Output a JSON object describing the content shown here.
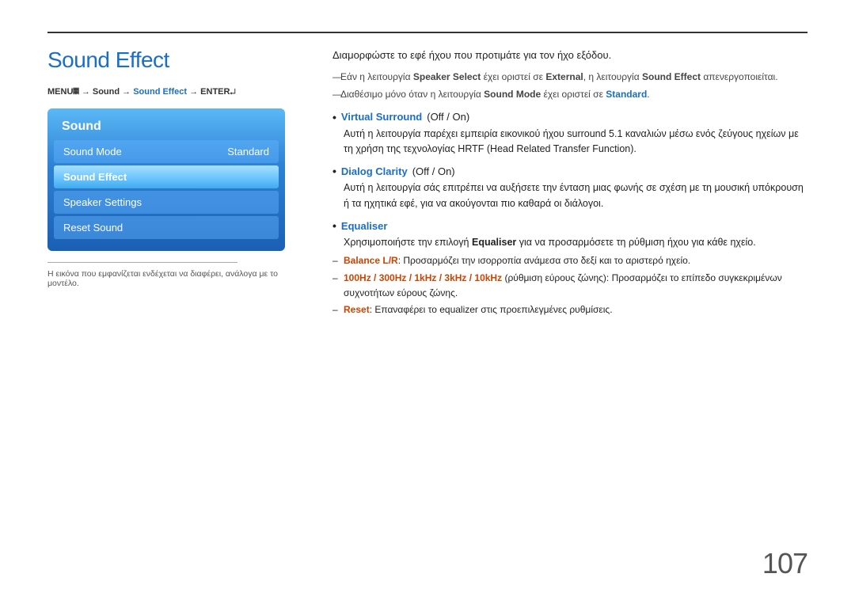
{
  "page": {
    "title": "Sound Effect",
    "page_number": "107",
    "top_rule": true
  },
  "menu_path": {
    "prefix": "MENU",
    "symbol": "𝄜",
    "path": " → Sound → Sound Effect → ENTER",
    "enter_symbol": "↵"
  },
  "menu_panel": {
    "title": "Sound",
    "items": [
      {
        "label": "Sound Mode",
        "value": "Standard",
        "state": "normal"
      },
      {
        "label": "Sound Effect",
        "value": "",
        "state": "selected"
      },
      {
        "label": "Speaker Settings",
        "value": "",
        "state": "normal"
      },
      {
        "label": "Reset Sound",
        "value": "",
        "state": "normal"
      }
    ]
  },
  "footnote": "Η εικόνα που εμφανίζεται ενδέχεται να διαφέρει, ανάλογα με το μοντέλο.",
  "right_column": {
    "intro": "Διαμορφώστε το εφέ ήχου που προτιμάτε για τον ήχο εξόδου.",
    "notes": [
      {
        "text_parts": [
          {
            "text": "Εάν η λειτουργία ",
            "style": "normal"
          },
          {
            "text": "Speaker Select",
            "style": "bold"
          },
          {
            "text": " έχει οριστεί σε ",
            "style": "normal"
          },
          {
            "text": "External",
            "style": "bold"
          },
          {
            "text": ", η λειτουργία ",
            "style": "normal"
          },
          {
            "text": "Sound Effect",
            "style": "bold"
          },
          {
            "text": " απενεργοποιείται.",
            "style": "normal"
          }
        ]
      },
      {
        "text_parts": [
          {
            "text": "Διαθέσιμο μόνο όταν η λειτουργία ",
            "style": "normal"
          },
          {
            "text": "Sound Mode",
            "style": "bold"
          },
          {
            "text": " έχει οριστεί σε ",
            "style": "normal"
          },
          {
            "text": "Standard",
            "style": "bold-orange"
          },
          {
            "text": ".",
            "style": "normal"
          }
        ]
      }
    ],
    "bullets": [
      {
        "title": "Virtual Surround",
        "title_suffix": " (Off / On)",
        "desc": "Αυτή η λειτουργία παρέχει εμπειρία εικονικού ήχου surround 5.1 καναλιών μέσω ενός ζεύγους ηχείων με τη χρήση της τεχνολογίας HRTF (Head Related Transfer Function).",
        "sub_bullets": []
      },
      {
        "title": "Dialog Clarity",
        "title_suffix": " (Off / On)",
        "desc": "Αυτή η λειτουργία σάς επιτρέπει να αυξήσετε την ένταση μιας φωνής σε σχέση με τη μουσική υπόκρουση ή τα ηχητικά εφέ, για να ακούγονται πιο καθαρά οι διάλογοι.",
        "sub_bullets": []
      },
      {
        "title": "Equaliser",
        "title_suffix": "",
        "desc": "Χρησιμοποιήστε την επιλογή Equaliser για να προσαρμόσετε τη ρύθμιση ήχου για κάθε ηχείο.",
        "sub_bullets": [
          {
            "parts": [
              {
                "text": "Balance L/R",
                "style": "orange-bold"
              },
              {
                "text": ": Προσαρμόζει την ισορροπία ανάμεσα στο δεξί και το αριστερό ηχείο.",
                "style": "normal"
              }
            ]
          },
          {
            "parts": [
              {
                "text": "100Hz / 300Hz / 1kHz / 3kHz / 10kHz",
                "style": "orange-bold"
              },
              {
                "text": " (ρύθμιση εύρους ζώνης): Προσαρμόζει το επίπεδο συγκεκριμένων συχνοτήτων εύρους ζώνης.",
                "style": "normal"
              }
            ]
          },
          {
            "parts": [
              {
                "text": "Reset",
                "style": "orange-bold"
              },
              {
                "text": ": Επαναφέρει το equalizer στις προεπιλεγμένες ρυθμίσεις.",
                "style": "normal"
              }
            ]
          }
        ]
      }
    ]
  }
}
